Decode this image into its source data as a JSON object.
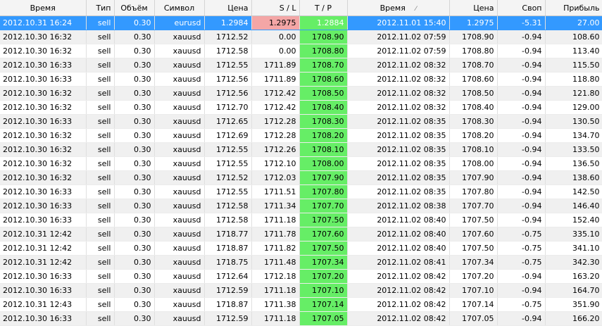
{
  "columns": {
    "time_open": "Время",
    "type": "Тип",
    "volume": "Объём",
    "symbol": "Символ",
    "price_open": "Цена",
    "sl": "S / L",
    "tp": "T / P",
    "time_close": "Время",
    "time_close_sort": "⁄",
    "price_close": "Цена",
    "swap": "Своп",
    "profit": "Прибыль"
  },
  "colors": {
    "selected_row": "#3399ff",
    "tp_highlight": "#66ee66",
    "sl_highlight": "#f4a6a6"
  },
  "rows": [
    [
      "2012.10.31 16:24",
      "sell",
      "0.30",
      "eurusd",
      "1.2984",
      "1.2975",
      "1.2884",
      "2012.11.01 15:40",
      "1.2975",
      "-5.31",
      "27.00"
    ],
    [
      "2012.10.30 16:32",
      "sell",
      "0.30",
      "xauusd",
      "1712.52",
      "0.00",
      "1708.90",
      "2012.11.02 07:59",
      "1708.90",
      "-0.94",
      "108.60"
    ],
    [
      "2012.10.30 16:32",
      "sell",
      "0.30",
      "xauusd",
      "1712.58",
      "0.00",
      "1708.80",
      "2012.11.02 07:59",
      "1708.80",
      "-0.94",
      "113.40"
    ],
    [
      "2012.10.30 16:33",
      "sell",
      "0.30",
      "xauusd",
      "1712.55",
      "1711.89",
      "1708.70",
      "2012.11.02 08:32",
      "1708.70",
      "-0.94",
      "115.50"
    ],
    [
      "2012.10.30 16:33",
      "sell",
      "0.30",
      "xauusd",
      "1712.56",
      "1711.89",
      "1708.60",
      "2012.11.02 08:32",
      "1708.60",
      "-0.94",
      "118.80"
    ],
    [
      "2012.10.30 16:32",
      "sell",
      "0.30",
      "xauusd",
      "1712.56",
      "1712.42",
      "1708.50",
      "2012.11.02 08:32",
      "1708.50",
      "-0.94",
      "121.80"
    ],
    [
      "2012.10.30 16:32",
      "sell",
      "0.30",
      "xauusd",
      "1712.70",
      "1712.42",
      "1708.40",
      "2012.11.02 08:32",
      "1708.40",
      "-0.94",
      "129.00"
    ],
    [
      "2012.10.30 16:33",
      "sell",
      "0.30",
      "xauusd",
      "1712.65",
      "1712.28",
      "1708.30",
      "2012.11.02 08:35",
      "1708.30",
      "-0.94",
      "130.50"
    ],
    [
      "2012.10.30 16:32",
      "sell",
      "0.30",
      "xauusd",
      "1712.69",
      "1712.28",
      "1708.20",
      "2012.11.02 08:35",
      "1708.20",
      "-0.94",
      "134.70"
    ],
    [
      "2012.10.30 16:32",
      "sell",
      "0.30",
      "xauusd",
      "1712.55",
      "1712.26",
      "1708.10",
      "2012.11.02 08:35",
      "1708.10",
      "-0.94",
      "133.50"
    ],
    [
      "2012.10.30 16:32",
      "sell",
      "0.30",
      "xauusd",
      "1712.55",
      "1712.10",
      "1708.00",
      "2012.11.02 08:35",
      "1708.00",
      "-0.94",
      "136.50"
    ],
    [
      "2012.10.30 16:32",
      "sell",
      "0.30",
      "xauusd",
      "1712.52",
      "1712.03",
      "1707.90",
      "2012.11.02 08:35",
      "1707.90",
      "-0.94",
      "138.60"
    ],
    [
      "2012.10.30 16:33",
      "sell",
      "0.30",
      "xauusd",
      "1712.55",
      "1711.51",
      "1707.80",
      "2012.11.02 08:35",
      "1707.80",
      "-0.94",
      "142.50"
    ],
    [
      "2012.10.30 16:33",
      "sell",
      "0.30",
      "xauusd",
      "1712.58",
      "1711.34",
      "1707.70",
      "2012.11.02 08:38",
      "1707.70",
      "-0.94",
      "146.40"
    ],
    [
      "2012.10.30 16:33",
      "sell",
      "0.30",
      "xauusd",
      "1712.58",
      "1711.18",
      "1707.50",
      "2012.11.02 08:40",
      "1707.50",
      "-0.94",
      "152.40"
    ],
    [
      "2012.10.31 12:42",
      "sell",
      "0.30",
      "xauusd",
      "1718.77",
      "1711.78",
      "1707.60",
      "2012.11.02 08:40",
      "1707.60",
      "-0.75",
      "335.10"
    ],
    [
      "2012.10.31 12:42",
      "sell",
      "0.30",
      "xauusd",
      "1718.87",
      "1711.82",
      "1707.50",
      "2012.11.02 08:40",
      "1707.50",
      "-0.75",
      "341.10"
    ],
    [
      "2012.10.31 12:42",
      "sell",
      "0.30",
      "xauusd",
      "1718.75",
      "1711.48",
      "1707.34",
      "2012.11.02 08:41",
      "1707.34",
      "-0.75",
      "342.30"
    ],
    [
      "2012.10.30 16:33",
      "sell",
      "0.30",
      "xauusd",
      "1712.64",
      "1712.18",
      "1707.20",
      "2012.11.02 08:42",
      "1707.20",
      "-0.94",
      "163.20"
    ],
    [
      "2012.10.30 16:33",
      "sell",
      "0.30",
      "xauusd",
      "1712.59",
      "1711.18",
      "1707.10",
      "2012.11.02 08:42",
      "1707.10",
      "-0.94",
      "164.70"
    ],
    [
      "2012.10.31 12:43",
      "sell",
      "0.30",
      "xauusd",
      "1718.87",
      "1711.38",
      "1707.14",
      "2012.11.02 08:42",
      "1707.14",
      "-0.75",
      "351.90"
    ],
    [
      "2012.10.30 16:33",
      "sell",
      "0.30",
      "xauusd",
      "1712.59",
      "1711.18",
      "1707.05",
      "2012.11.02 08:42",
      "1707.05",
      "-0.94",
      "166.20"
    ]
  ]
}
